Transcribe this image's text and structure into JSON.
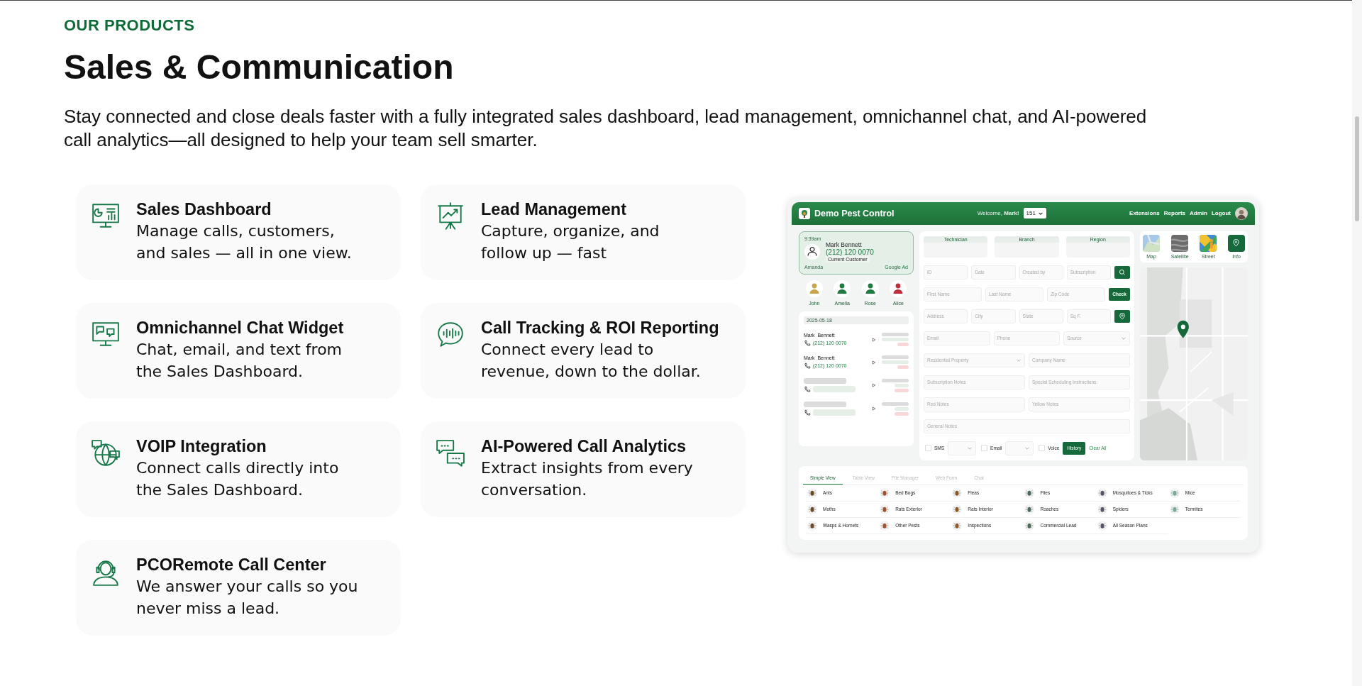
{
  "section_label": "OUR PRODUCTS",
  "heading": "Sales & Communication",
  "intro": "Stay connected and close deals faster with a fully integrated sales dashboard, lead management, omnichannel chat, and AI-powered call analytics—all designed to help your team sell smarter.",
  "products": [
    {
      "title": "Sales Dashboard",
      "description": "Manage calls, customers, and sales — all in one view."
    },
    {
      "title": "Lead Management",
      "description": "Capture, organize, and follow up — fast"
    },
    {
      "title": "Omnichannel Chat Widget",
      "description": "Chat, email, and text from the Sales Dashboard."
    },
    {
      "title": "Call Tracking & ROI Reporting",
      "description": "Connect every lead to revenue, down to the dollar."
    },
    {
      "title": "VOIP Integration",
      "description": "Connect calls directly into the Sales Dashboard."
    },
    {
      "title": "AI-Powered Call Analytics",
      "description": "Extract insights from every conversation."
    },
    {
      "title": "PCORemote Call Center",
      "description": "We answer your calls so you never miss a lead."
    }
  ],
  "dashboard": {
    "brand": "Demo Pest Control",
    "welcome": "Welcome, **Mark!**",
    "extension": "151",
    "nav_links": [
      "Extensions",
      "Reports",
      "Admin",
      "Logout"
    ],
    "current_call": {
      "time": "9:39am",
      "name": "Mark Bennett",
      "phone": "(212) 120 0070",
      "status": "Current Customer",
      "agent": "Amanda",
      "source": "Google Ad"
    },
    "agents": [
      {
        "name": "John",
        "color": "#c9a64a"
      },
      {
        "name": "Amelia",
        "color": "#1f7a40"
      },
      {
        "name": "Rose",
        "color": "#1f7a40"
      },
      {
        "name": "Alice",
        "color": "#c0303a"
      }
    ],
    "call_log": {
      "date": "2025-05-18",
      "calls": [
        {
          "name": "Mark  Bennett",
          "phone": "(212) 120 0070"
        },
        {
          "name": "Mark  Bennett",
          "phone": "(212) 120 0070"
        }
      ]
    },
    "assignments": [
      "Technician",
      "Branch",
      "Region"
    ],
    "form_rows": [
      [
        {
          "kind": "field",
          "placeholder": "ID"
        },
        {
          "kind": "field",
          "placeholder": "Date"
        },
        {
          "kind": "field",
          "placeholder": "Created by"
        },
        {
          "kind": "field",
          "placeholder": "Subscription"
        },
        {
          "kind": "search-button"
        }
      ],
      [
        {
          "kind": "field",
          "placeholder": "First Name"
        },
        {
          "kind": "field",
          "placeholder": "Last Name"
        },
        {
          "kind": "field",
          "placeholder": "Zip Code"
        },
        {
          "kind": "text-button",
          "label": "Check"
        }
      ],
      [
        {
          "kind": "field",
          "placeholder": "Address"
        },
        {
          "kind": "field",
          "placeholder": "City"
        },
        {
          "kind": "field",
          "placeholder": "State"
        },
        {
          "kind": "field",
          "placeholder": "Sq F."
        },
        {
          "kind": "location-button"
        }
      ],
      [
        {
          "kind": "field",
          "placeholder": "Email"
        },
        {
          "kind": "field",
          "placeholder": "Phone"
        },
        {
          "kind": "select",
          "placeholder": "Source"
        }
      ],
      [
        {
          "kind": "select",
          "placeholder": "Residential Property"
        },
        {
          "kind": "field",
          "placeholder": "Company Name"
        }
      ],
      [
        {
          "kind": "field",
          "placeholder": "Subscription Notes"
        },
        {
          "kind": "field",
          "placeholder": "Special Scheduling Instructions"
        }
      ],
      [
        {
          "kind": "field",
          "placeholder": "Red Notes"
        },
        {
          "kind": "field",
          "placeholder": "Yellow Notes"
        }
      ],
      [
        {
          "kind": "field",
          "placeholder": "General Notes"
        }
      ],
      [
        {
          "kind": "checkbox",
          "label": "SMS",
          "checked": false
        },
        {
          "kind": "select"
        },
        {
          "kind": "checkbox",
          "label": "Email",
          "checked": false
        },
        {
          "kind": "select"
        },
        {
          "kind": "checkbox",
          "label": "Voice",
          "checked": false
        },
        {
          "kind": "primary-button",
          "label": "History"
        },
        {
          "kind": "link",
          "label": "Clear All"
        }
      ]
    ],
    "map_views": [
      {
        "kind": "map",
        "label": "Map",
        "selected": false
      },
      {
        "kind": "satellite",
        "label": "Satellite",
        "selected": false
      },
      {
        "kind": "street",
        "label": "Street",
        "selected": false
      },
      {
        "kind": "info",
        "label": "Info",
        "selected": true
      }
    ],
    "view_tabs": [
      {
        "label": "Simple View",
        "selected": true
      },
      {
        "label": "Table View",
        "selected": false
      },
      {
        "label": "File Manager",
        "selected": false
      },
      {
        "label": "Web Form",
        "selected": false
      },
      {
        "label": "Chat",
        "selected": false
      }
    ],
    "pests": [
      "Ants",
      "Bed Bugs",
      "Fleas",
      "Flies",
      "Mosquitoes & Ticks",
      "Mice",
      "Moths",
      "Rats Exterior",
      "Rats Interior",
      "Roaches",
      "Spiders",
      "Termites",
      "Wasps & Hornets",
      "Other Pests",
      "Inspections",
      "Commercial Lead",
      "All Season Plans"
    ]
  }
}
